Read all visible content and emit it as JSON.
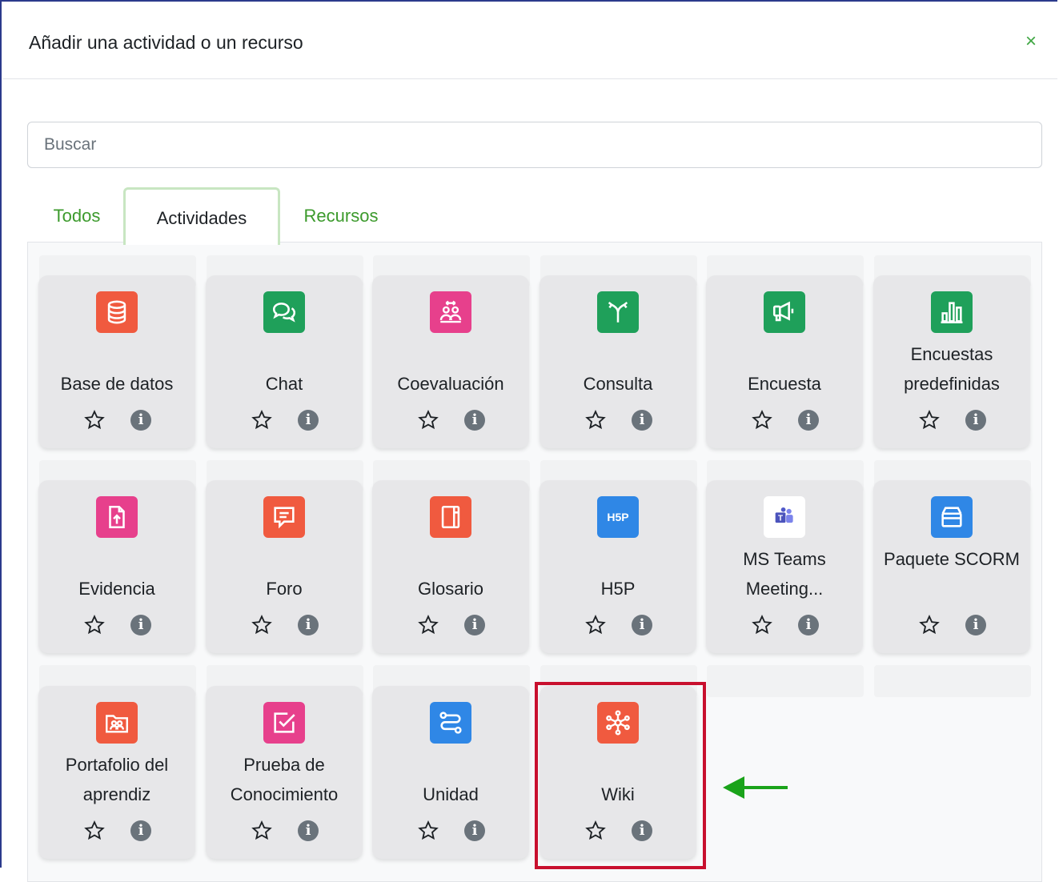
{
  "dialog": {
    "title": "Añadir una actividad o un recurso",
    "close_glyph": "×"
  },
  "search": {
    "placeholder": "Buscar",
    "value": ""
  },
  "tabs": [
    {
      "label": "Todos",
      "active": false
    },
    {
      "label": "Actividades",
      "active": true
    },
    {
      "label": "Recursos",
      "active": false
    }
  ],
  "colors": {
    "accent_green": "#3fa642",
    "highlight_red": "#c8102e",
    "icon_orange": "#f05a3f",
    "icon_green": "#1fa05a",
    "icon_pink": "#e7408c",
    "icon_blue": "#2f87e6"
  },
  "modules": [
    {
      "label": "Base de datos",
      "icon": "database-icon"
    },
    {
      "label": "Chat",
      "icon": "chat-icon"
    },
    {
      "label": "Coevaluación",
      "icon": "peer-assessment-icon"
    },
    {
      "label": "Consulta",
      "icon": "signpost-icon"
    },
    {
      "label": "Encuesta",
      "icon": "megaphone-icon"
    },
    {
      "label": "Encuestas predefinidas",
      "icon": "bar-chart-icon"
    },
    {
      "label": "Evidencia",
      "icon": "file-upload-icon"
    },
    {
      "label": "Foro",
      "icon": "forum-icon"
    },
    {
      "label": "Glosario",
      "icon": "book-icon"
    },
    {
      "label": "H5P",
      "icon": "h5p-icon"
    },
    {
      "label": "MS Teams Meeting...",
      "icon": "teams-icon"
    },
    {
      "label": "Paquete SCORM",
      "icon": "package-icon"
    },
    {
      "label": "Portafolio del aprendiz",
      "icon": "portfolio-icon"
    },
    {
      "label": "Prueba de Conocimiento",
      "icon": "quiz-icon"
    },
    {
      "label": "Unidad",
      "icon": "route-icon"
    },
    {
      "label": "Wiki",
      "icon": "wiki-icon"
    }
  ]
}
